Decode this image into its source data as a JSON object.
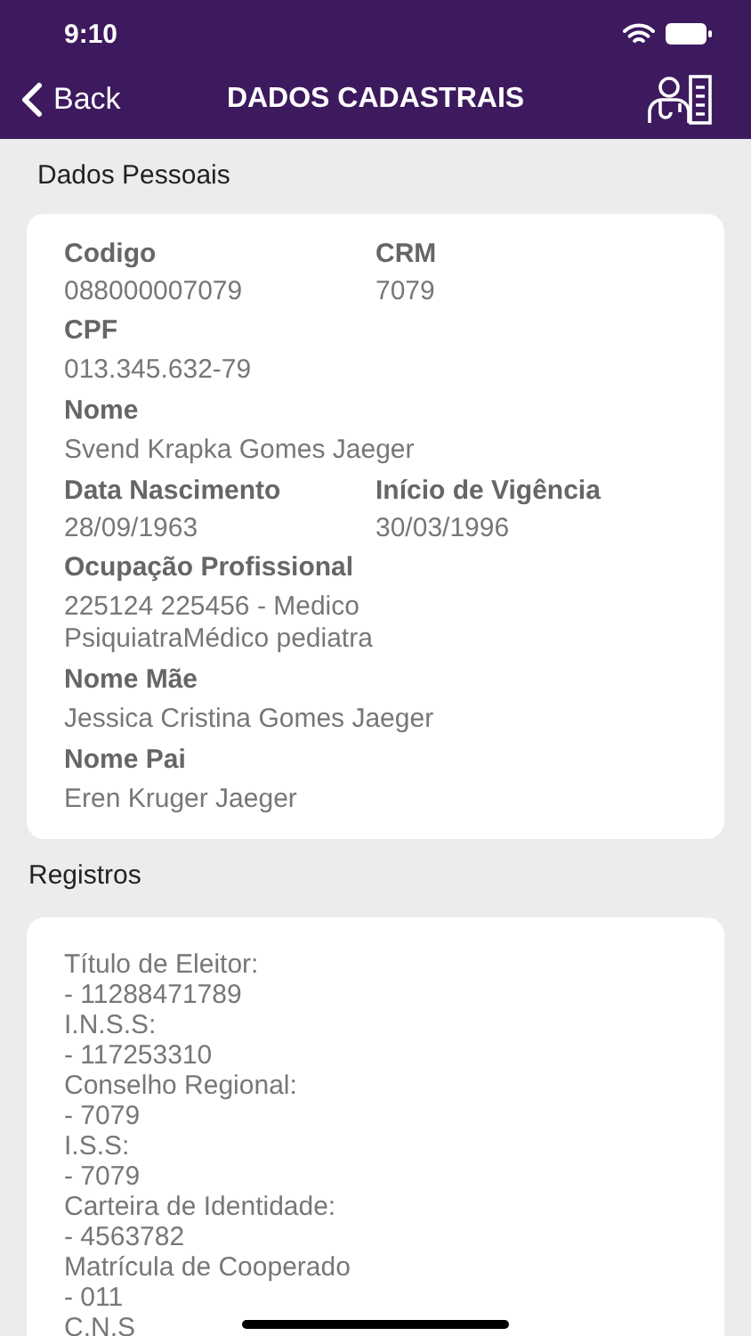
{
  "status_bar": {
    "time": "9:10"
  },
  "nav": {
    "back": "Back",
    "title": "DADOS CADASTRAIS"
  },
  "personal": {
    "heading": "Dados Pessoais",
    "rows": [
      [
        {
          "label": "Codigo",
          "value": "088000007079"
        },
        {
          "label": "CRM",
          "value": "7079"
        }
      ],
      [
        {
          "label": "CPF",
          "value": "013.345.632-79"
        }
      ],
      [
        {
          "label": "Nome",
          "value": "Svend Krapka Gomes Jaeger"
        }
      ],
      [
        {
          "label": "Data Nascimento",
          "value": "28/09/1963"
        },
        {
          "label": "Início de Vigência",
          "value": "30/03/1996"
        }
      ],
      [
        {
          "label": "Ocupação Profissional",
          "value": "225124 225456 - Medico PsiquiatraMédico pediatra"
        }
      ],
      [
        {
          "label": "Nome Mãe",
          "value": "Jessica Cristina Gomes Jaeger"
        }
      ],
      [
        {
          "label": "Nome Pai",
          "value": "Eren Kruger Jaeger"
        }
      ]
    ]
  },
  "registros": {
    "heading": "Registros",
    "lines": [
      "Título de Eleitor:",
      "- 11288471789",
      "I.N.S.S:",
      "- 117253310",
      "Conselho Regional:",
      "- 7079",
      "I.S.S:",
      "- 7079",
      "Carteira de Identidade:",
      "- 4563782",
      "Matrícula de Cooperado",
      "- 011",
      "C.N.S"
    ]
  }
}
